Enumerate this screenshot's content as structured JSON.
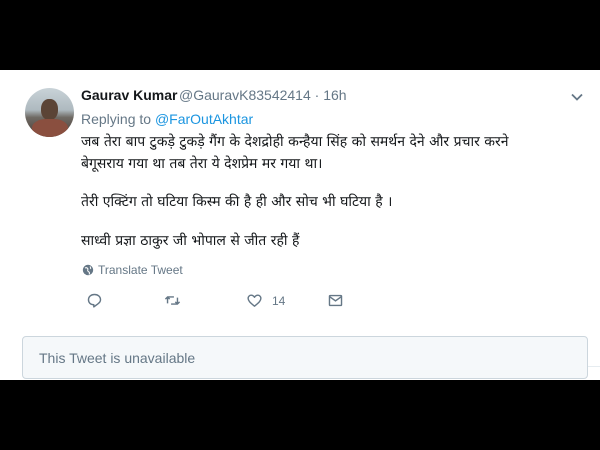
{
  "tweet": {
    "name": "Gaurav Kumar",
    "handle": "@GauravK83542414",
    "time": "· 16h",
    "replying_prefix": "Replying to",
    "replying_handle": "@FarOutAkhtar",
    "lines": [
      "जब तेरा बाप टुकड़े टुकड़े गैंग के देशद्रोही कन्हैया सिंह को समर्थन देने और प्रचार करने",
      "बेगूसराय गया था तब तेरा ये देशप्रेम मर गया था।",
      "तेरी एक्टिंग तो घटिया किस्म की है ही और सोच भी घटिया है ।",
      "साध्वी प्रज्ञा ठाकुर जी भोपाल से जीत रही हैं"
    ],
    "translate_label": "Translate Tweet",
    "like_count": "14"
  },
  "unavailable_text": "This Tweet is unavailable",
  "colors": {
    "accent": "#1b95e0",
    "muted": "#657786",
    "text": "#14171a"
  }
}
